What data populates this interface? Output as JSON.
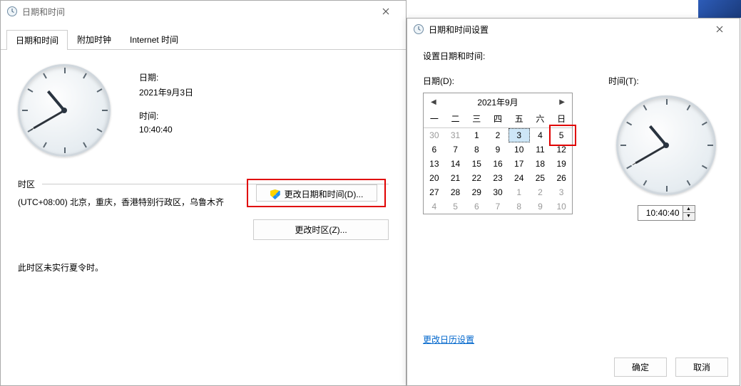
{
  "left": {
    "title": "日期和时间",
    "tabs": [
      "日期和时间",
      "附加时钟",
      "Internet 时间"
    ],
    "active_tab": 0,
    "date_label": "日期:",
    "date_value": "2021年9月3日",
    "time_label": "时间:",
    "time_value": "10:40:40",
    "change_dt_btn": "更改日期和时间(D)...",
    "tz_heading": "时区",
    "tz_value": "(UTC+08:00) 北京，重庆，香港特别行政区，乌鲁木齐",
    "change_tz_btn": "更改时区(Z)...",
    "dst_note": "此时区未实行夏令时。"
  },
  "right": {
    "title": "日期和时间设置",
    "heading": "设置日期和时间:",
    "date_label": "日期(D):",
    "time_label": "时间(T):",
    "cal": {
      "month_title": "2021年9月",
      "dow": [
        "一",
        "二",
        "三",
        "四",
        "五",
        "六",
        "日"
      ],
      "rows": [
        [
          {
            "d": 30,
            "out": true
          },
          {
            "d": 31,
            "out": true
          },
          {
            "d": 1
          },
          {
            "d": 2
          },
          {
            "d": 3,
            "sel": true
          },
          {
            "d": 4
          },
          {
            "d": 5,
            "hl": true
          }
        ],
        [
          {
            "d": 6
          },
          {
            "d": 7
          },
          {
            "d": 8
          },
          {
            "d": 9
          },
          {
            "d": 10
          },
          {
            "d": 11
          },
          {
            "d": 12
          }
        ],
        [
          {
            "d": 13
          },
          {
            "d": 14
          },
          {
            "d": 15
          },
          {
            "d": 16
          },
          {
            "d": 17
          },
          {
            "d": 18
          },
          {
            "d": 19
          }
        ],
        [
          {
            "d": 20
          },
          {
            "d": 21
          },
          {
            "d": 22
          },
          {
            "d": 23
          },
          {
            "d": 24
          },
          {
            "d": 25
          },
          {
            "d": 26
          }
        ],
        [
          {
            "d": 27
          },
          {
            "d": 28
          },
          {
            "d": 29
          },
          {
            "d": 30
          },
          {
            "d": 1,
            "out": true
          },
          {
            "d": 2,
            "out": true
          },
          {
            "d": 3,
            "out": true
          }
        ],
        [
          {
            "d": 4,
            "out": true
          },
          {
            "d": 5,
            "out": true
          },
          {
            "d": 6,
            "out": true
          },
          {
            "d": 7,
            "out": true
          },
          {
            "d": 8,
            "out": true
          },
          {
            "d": 9,
            "out": true
          },
          {
            "d": 10,
            "out": true
          }
        ]
      ]
    },
    "time_value": "10:40:40",
    "cal_link": "更改日历设置",
    "ok_btn": "确定",
    "cancel_btn": "取消"
  },
  "clock": {
    "h": 10,
    "m": 40,
    "s": 40
  }
}
